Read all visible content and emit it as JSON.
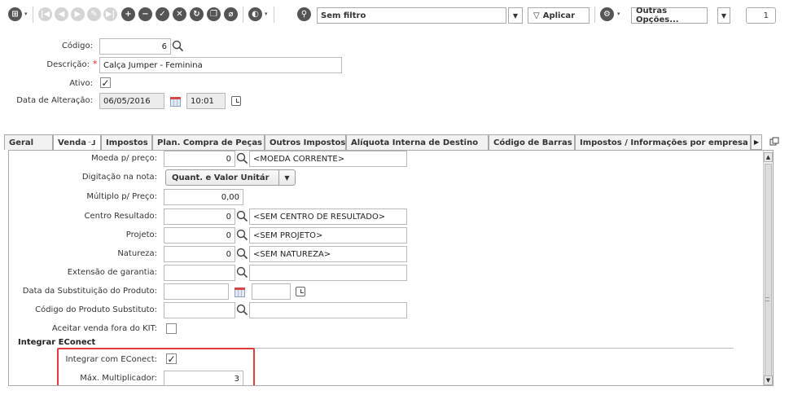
{
  "toolbar": {
    "filter_value": "Sem filtro",
    "apply_label": "Aplicar",
    "more_options_label": "Outras Opções...",
    "page_number": "1"
  },
  "header": {
    "codigo_label": "Código:",
    "codigo_value": "6",
    "descricao_label": "Descrição:",
    "required_mark": "*",
    "descricao_value": "Calça Jumper - Feminina",
    "ativo_label": "Ativo:",
    "ativo_checked": "✓",
    "data_alteracao_label": "Data de Alteração:",
    "data_value": "06/05/2016",
    "hora_value": "10:01"
  },
  "tabs": [
    {
      "label": "Geral"
    },
    {
      "label": "Venda"
    },
    {
      "label": "Impostos"
    },
    {
      "label": "Plan. Compra de Peças"
    },
    {
      "label": "Outros Impostos"
    },
    {
      "label": "Alíquota Interna de Destino"
    },
    {
      "label": "Código de Barras"
    },
    {
      "label": "Impostos / Informações por empresa"
    }
  ],
  "venda": {
    "moeda_label": "Moeda p/ preço:",
    "moeda_code": "0",
    "moeda_desc": "<MOEDA CORRENTE>",
    "digitacao_label": "Digitação na nota:",
    "digitacao_value": "Quant. e Valor Unitár",
    "multiplo_label": "Múltiplo p/ Preço:",
    "multiplo_value": "0,00",
    "centro_label": "Centro Resultado:",
    "centro_code": "0",
    "centro_desc": "<SEM CENTRO DE RESULTADO>",
    "projeto_label": "Projeto:",
    "projeto_code": "0",
    "projeto_desc": "<SEM PROJETO>",
    "natureza_label": "Natureza:",
    "natureza_code": "0",
    "natureza_desc": "<SEM NATUREZA>",
    "garantia_label": "Extensão de garantia:",
    "data_subst_label": "Data da Substituição do Produto:",
    "codigo_subst_label": "Código do Produto Substituto:",
    "aceitar_kit_label": "Aceitar venda fora do KIT:",
    "econect_section": "Integrar EConect",
    "integrar_label": "Integrar com EConect:",
    "integrar_checked": "✓",
    "max_mult_label": "Máx. Multiplicador:",
    "max_mult_value": "3"
  },
  "colors": {
    "highlight": "#e03b3b",
    "required": "#dd2222"
  }
}
